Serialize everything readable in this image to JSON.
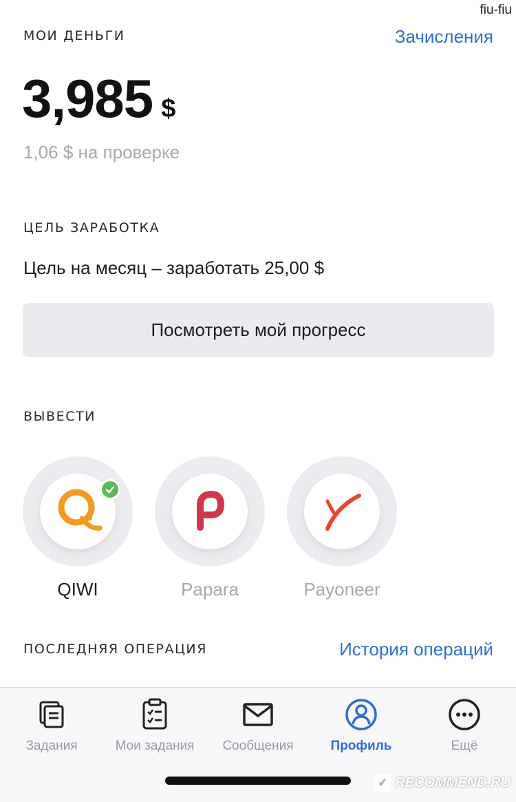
{
  "watermark_top": "fiu-fiu",
  "money": {
    "label": "МОИ ДЕНЬГИ",
    "link": "Зачисления",
    "amount": "3,985",
    "currency": "$",
    "pending": "1,06 $ на проверке"
  },
  "goal": {
    "label": "ЦЕЛЬ ЗАРАБОТКА",
    "text": "Цель на месяц – заработать 25,00 $",
    "button": "Посмотреть мой прогресс"
  },
  "withdraw": {
    "label": "ВЫВЕСТИ",
    "methods": [
      {
        "name": "QIWI",
        "icon": "qiwi-logo-icon",
        "selected": true
      },
      {
        "name": "Papara",
        "icon": "papara-logo-icon",
        "selected": false
      },
      {
        "name": "Payoneer",
        "icon": "payoneer-logo-icon",
        "selected": false
      }
    ]
  },
  "last_operation": {
    "label": "ПОСЛЕДНЯЯ ОПЕРАЦИЯ",
    "link": "История операций"
  },
  "tabbar": {
    "tabs": [
      {
        "label": "Задания",
        "icon": "tasks-icon",
        "active": false
      },
      {
        "label": "Мои задания",
        "icon": "clipboard-icon",
        "active": false
      },
      {
        "label": "Сообщения",
        "icon": "envelope-icon",
        "active": false
      },
      {
        "label": "Профиль",
        "icon": "profile-icon",
        "active": true
      },
      {
        "label": "Ещё",
        "icon": "more-icon",
        "active": false
      }
    ]
  },
  "watermark_bottom": "RECOMMEND.RU",
  "colors": {
    "accent": "#2f6fd1",
    "muted": "#a6a8b2",
    "button_bg": "#ebebef",
    "check": "#5cb85c",
    "qiwi_orange": "#f39a1e",
    "papara_red": "#d2364b",
    "payoneer_orange": "#e8462c"
  }
}
